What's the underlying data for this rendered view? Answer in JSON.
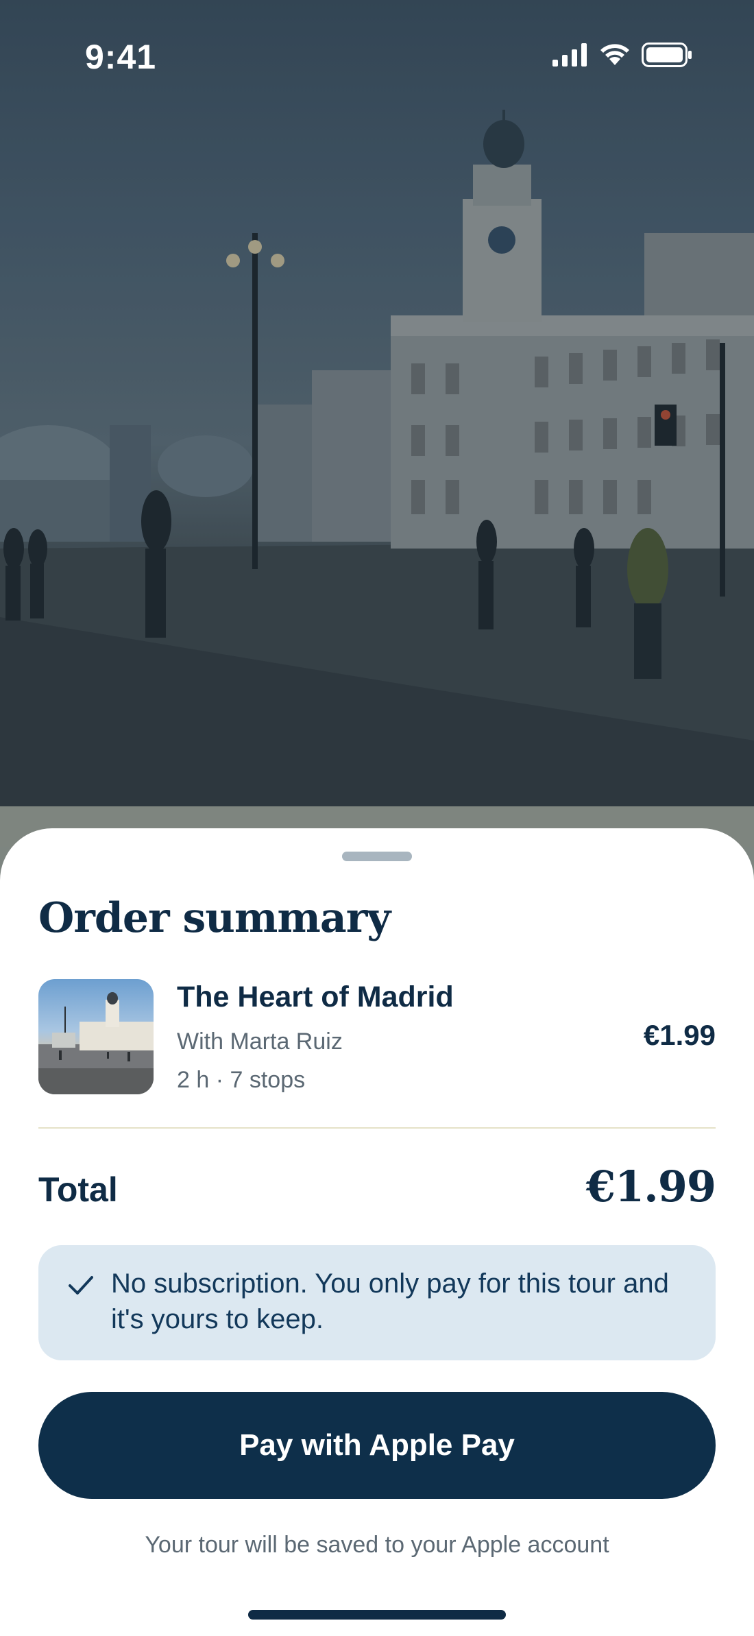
{
  "status_bar": {
    "time": "9:41",
    "icons": [
      "cellular-signal-icon",
      "wifi-icon",
      "battery-icon"
    ]
  },
  "hero": {
    "image": "photo-puerta-del-sol-madrid"
  },
  "order_summary": {
    "title": "Order summary",
    "tour": {
      "name": "The Heart of Madrid",
      "guide": "With Marta Ruiz",
      "meta": "2 h · 7 stops",
      "price": "€1.99",
      "thumbnail": "tour-thumbnail"
    },
    "total_label": "Total",
    "total_value": "€1.99",
    "notice": {
      "icon": "checkmark-icon",
      "text": "No subscription. You only pay for this tour and it's yours to keep."
    },
    "pay_button_label": "Pay with Apple Pay",
    "footnote": "Your tour will be saved to your Apple account"
  },
  "colors": {
    "primary": "#0e2f4a",
    "notice_bg": "#dce8f1",
    "secondary_text": "#5b6873",
    "divider": "#e5e2c8"
  }
}
